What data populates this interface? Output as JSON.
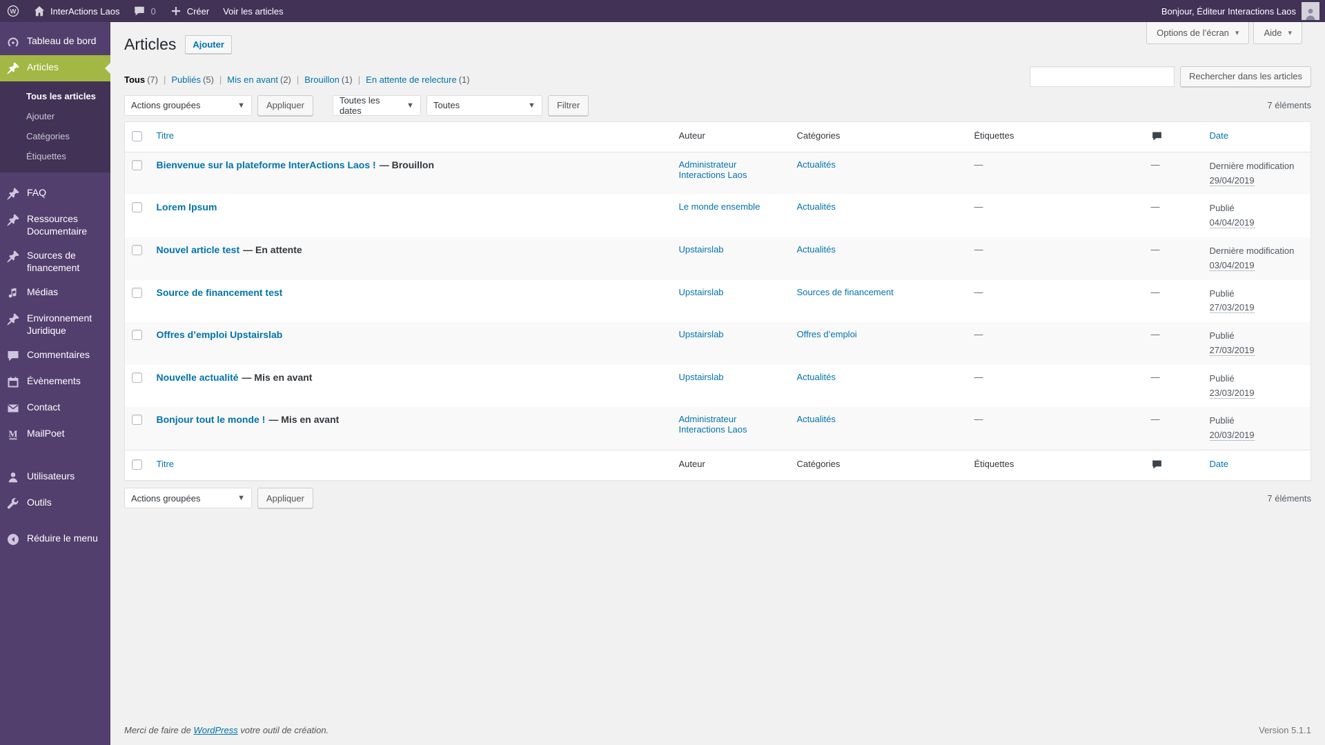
{
  "colors": {
    "adminbar_bg": "#413256",
    "sidebar_bg": "#523f6d",
    "highlight_green": "#a3b745",
    "link_blue": "#0073aa",
    "page_bg": "#f1f1f1"
  },
  "admin_bar": {
    "site_name": "InterActions Laos",
    "comment_count": "0",
    "create_label": "Créer",
    "view_posts_label": "Voir les articles",
    "greeting": "Bonjour, Éditeur Interactions Laos"
  },
  "sidebar": {
    "dashboard": "Tableau de bord",
    "articles": "Articles",
    "articles_submenu": {
      "all": "Tous les articles",
      "add": "Ajouter",
      "categories": "Catégories",
      "tags": "Étiquettes"
    },
    "faq": "FAQ",
    "resources": "Ressources Documentaire",
    "funding": "Sources de financement",
    "media": "Médias",
    "legal": "Environnement Juridique",
    "comments": "Commentaires",
    "events": "Évènements",
    "contact": "Contact",
    "mailpoet": "MailPoet",
    "users": "Utilisateurs",
    "tools": "Outils",
    "collapse": "Réduire le menu"
  },
  "page": {
    "title": "Articles",
    "add_button": "Ajouter",
    "screen_options": "Options de l’écran",
    "help": "Aide"
  },
  "views": [
    {
      "label": "Tous",
      "count": "(7)"
    },
    {
      "label": "Publiés",
      "count": "(5)"
    },
    {
      "label": "Mis en avant",
      "count": "(2)"
    },
    {
      "label": "Brouillon",
      "count": "(1)"
    },
    {
      "label": "En attente de relecture",
      "count": "(1)"
    }
  ],
  "toolbar": {
    "bulk_actions": "Actions groupées",
    "apply": "Appliquer",
    "all_dates": "Toutes les dates",
    "all_categories": "Toutes",
    "filter": "Filtrer",
    "search_button": "Rechercher dans les articles",
    "items_count": "7 éléments"
  },
  "table": {
    "headers": {
      "title": "Titre",
      "author": "Auteur",
      "categories": "Catégories",
      "tags": "Étiquettes",
      "date": "Date"
    },
    "rows": [
      {
        "title": "Bienvenue sur la plateforme InterActions Laos !",
        "state": "— Brouillon",
        "author": "Administrateur Interactions Laos",
        "category": "Actualités",
        "tags": "—",
        "comments": "—",
        "date_status": "Dernière modification",
        "date": "29/04/2019"
      },
      {
        "title": "Lorem Ipsum",
        "state": "",
        "author": "Le monde ensemble",
        "category": "Actualités",
        "tags": "—",
        "comments": "—",
        "date_status": "Publié",
        "date": "04/04/2019"
      },
      {
        "title": "Nouvel article test",
        "state": "— En attente",
        "author": "Upstairslab",
        "category": "Actualités",
        "tags": "—",
        "comments": "—",
        "date_status": "Dernière modification",
        "date": "03/04/2019"
      },
      {
        "title": "Source de financement test",
        "state": "",
        "author": "Upstairslab",
        "category": "Sources de financement",
        "tags": "—",
        "comments": "—",
        "date_status": "Publié",
        "date": "27/03/2019"
      },
      {
        "title": "Offres d’emploi Upstairslab",
        "state": "",
        "author": "Upstairslab",
        "category": "Offres d’emploi",
        "tags": "—",
        "comments": "—",
        "date_status": "Publié",
        "date": "27/03/2019"
      },
      {
        "title": "Nouvelle actualité",
        "state": "— Mis en avant",
        "author": "Upstairslab",
        "category": "Actualités",
        "tags": "—",
        "comments": "—",
        "date_status": "Publié",
        "date": "23/03/2019"
      },
      {
        "title": "Bonjour tout le monde !",
        "state": "— Mis en avant",
        "author": "Administrateur Interactions Laos",
        "category": "Actualités",
        "tags": "—",
        "comments": "—",
        "date_status": "Publié",
        "date": "20/03/2019"
      }
    ]
  },
  "footer": {
    "thanks_prefix": "Merci de faire de ",
    "wordpress_link": "WordPress",
    "thanks_suffix": " votre outil de création.",
    "version": "Version 5.1.1"
  },
  "icons": {
    "wordpress": "w-in-circle",
    "home": "house",
    "comment": "speech-bubble",
    "plus": "plus",
    "dashboard": "gauge",
    "post": "pushpin",
    "media": "music-notes",
    "events": "calendar",
    "contact": "envelope",
    "mailpoet": "letter-m",
    "users": "person",
    "tools": "wrench",
    "collapse": "circle-left-arrow"
  }
}
